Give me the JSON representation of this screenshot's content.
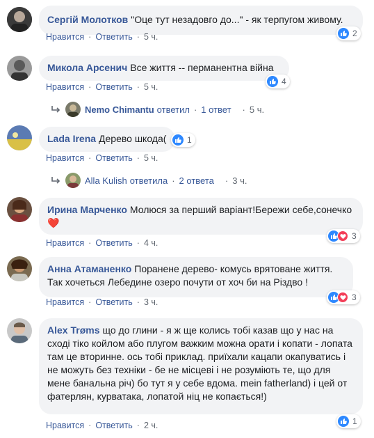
{
  "actions": {
    "like_label": "Нравится",
    "reply_label": "Ответить",
    "dot": "·"
  },
  "comments": [
    {
      "name": "Сергій Молотков",
      "text": "\"Оце тут незадовго до...\" - як терпугом живому.",
      "time": "5 ч.",
      "reactions": "2"
    },
    {
      "name": "Микола Арсенич",
      "text": "Все життя -- перманентна війна",
      "time": "5 ч.",
      "reactions": "4",
      "reply": {
        "name": "Nemo Chimantu",
        "verb": "ответил",
        "count": "1 ответ",
        "time": "5 ч."
      }
    },
    {
      "name": "Lada Irena",
      "text": "Дерево шкода(",
      "time": "5 ч.",
      "reactions": "1",
      "reply": {
        "name": "Alla Kulish",
        "verb": "ответила",
        "count": "2 ответа",
        "time": "3 ч."
      }
    },
    {
      "name": "Ирина Марченко",
      "text": "Молюся за перший варіант!Бережи себе,сонечко",
      "emoji": "❤️",
      "time": "4 ч.",
      "reactions": "3"
    },
    {
      "name": "Анна Атаманенко",
      "text": "Поранене дерево- комусь врятоване життя. Так хочеться Лебедине озеро почути от хоч би на Різдво !",
      "time": "3 ч.",
      "reactions": "3"
    },
    {
      "name": "Alex Trøms",
      "text": "що до глини - я ж ще колись тобі казав що у нас на сході тіко койлом або плугом важким можна орати і копати - лопата там це вторинне. ось тобі приклад. приїхали кацапи окапуватись і не можуть без техніки - бе не місцеві і не розуміють те, що для мене банальна річ) бо тут я у себе вдома. mein fatherland) і цей от фатерлян, курватака, лопатой ніц не копається!)",
      "time": "2 ч.",
      "reactions": "1"
    }
  ],
  "colors": {
    "link": "#385898",
    "bubble": "#f2f3f5",
    "like": "#2d88ff",
    "love": "#f33e58"
  }
}
